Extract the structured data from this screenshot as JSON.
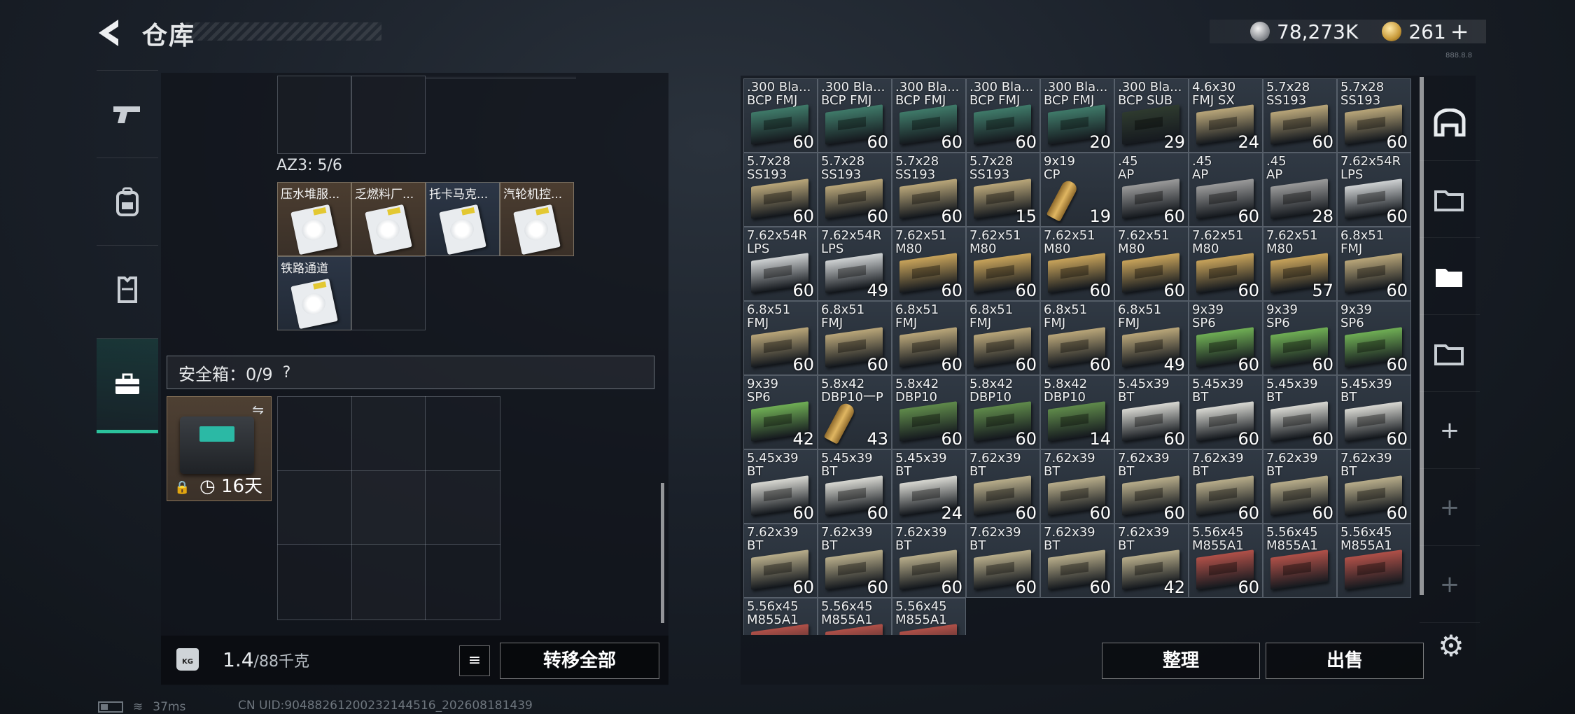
{
  "header": {
    "title": "仓库",
    "silver": "78,273K",
    "gold": "261",
    "plus": "+",
    "version": "888.8.8"
  },
  "left_tabs": [
    "weapon",
    "backpack",
    "vest",
    "safe-box"
  ],
  "az_label": "AZ3: 5/6",
  "az_items": [
    {
      "name": "压水堆服...",
      "style": "brown"
    },
    {
      "name": "乏燃料厂...",
      "style": "brown"
    },
    {
      "name": "托卡马克...",
      "style": "blue"
    },
    {
      "name": "汽轮机控...",
      "style": "brown"
    },
    {
      "name": "铁路通道",
      "style": "blue"
    }
  ],
  "safe": {
    "label": "安全箱：0/9",
    "help": "?",
    "timer": "16天",
    "swap": "⇋",
    "lock": "🔒"
  },
  "weight": {
    "value": "1.4",
    "unit": "/88千克",
    "kg": "KG"
  },
  "buttons": {
    "transfer_all": "转移全部",
    "organize": "整理",
    "sell": "出售",
    "list": "≡"
  },
  "right_tabs": [
    "stash-main",
    "stash-1",
    "stash-2",
    "stash-3",
    "add",
    "add",
    "add"
  ],
  "ammo": [
    {
      "label": ".300 Bla...\nBCP FMJ",
      "qty": "60",
      "color": "#3f7a69"
    },
    {
      "label": ".300 Bla...\nBCP FMJ",
      "qty": "60",
      "color": "#3f7a69"
    },
    {
      "label": ".300 Bla...\nBCP FMJ",
      "qty": "60",
      "color": "#3f7a69"
    },
    {
      "label": ".300 Bla...\nBCP FMJ",
      "qty": "60",
      "color": "#3f7a69"
    },
    {
      "label": ".300 Bla...\nBCP FMJ",
      "qty": "20",
      "color": "#3f7a69"
    },
    {
      "label": ".300 Bla...\nBCP SUB",
      "qty": "29",
      "color": "#2e3a2e"
    },
    {
      "label": "4.6x30\nFMJ SX",
      "qty": "24",
      "color": "#b9a679"
    },
    {
      "label": "5.7x28\nSS193",
      "qty": "60",
      "color": "#b9a679"
    },
    {
      "label": "5.7x28\nSS193",
      "qty": "60",
      "color": "#b9a679"
    },
    {
      "label": "5.7x28\nSS193",
      "qty": "60",
      "color": "#b9a679"
    },
    {
      "label": "5.7x28\nSS193",
      "qty": "60",
      "color": "#b9a679"
    },
    {
      "label": "5.7x28\nSS193",
      "qty": "60",
      "color": "#b9a679"
    },
    {
      "label": "5.7x28\nSS193",
      "qty": "15",
      "color": "#b9a679"
    },
    {
      "label": "9x19\nCP",
      "qty": "19",
      "color": "#bullet"
    },
    {
      "label": ".45\nAP",
      "qty": "60",
      "color": "#9a9a9a"
    },
    {
      "label": ".45\nAP",
      "qty": "60",
      "color": "#9a9a9a"
    },
    {
      "label": ".45\nAP",
      "qty": "28",
      "color": "#9a9a9a"
    },
    {
      "label": "7.62x54R\nLPS",
      "qty": "60",
      "color": "#cfd2d3"
    },
    {
      "label": "7.62x54R\nLPS",
      "qty": "60",
      "color": "#cfd2d3"
    },
    {
      "label": "7.62x54R\nLPS",
      "qty": "49",
      "color": "#cfd2d3"
    },
    {
      "label": "7.62x51\nM80",
      "qty": "60",
      "color": "#c8a35a"
    },
    {
      "label": "7.62x51\nM80",
      "qty": "60",
      "color": "#c8a35a"
    },
    {
      "label": "7.62x51\nM80",
      "qty": "60",
      "color": "#c8a35a"
    },
    {
      "label": "7.62x51\nM80",
      "qty": "60",
      "color": "#c8a35a"
    },
    {
      "label": "7.62x51\nM80",
      "qty": "60",
      "color": "#c8a35a"
    },
    {
      "label": "7.62x51\nM80",
      "qty": "57",
      "color": "#c8a35a"
    },
    {
      "label": "6.8x51\nFMJ",
      "qty": "60",
      "color": "#b9a679"
    },
    {
      "label": "6.8x51\nFMJ",
      "qty": "60",
      "color": "#b9a679"
    },
    {
      "label": "6.8x51\nFMJ",
      "qty": "60",
      "color": "#b9a679"
    },
    {
      "label": "6.8x51\nFMJ",
      "qty": "60",
      "color": "#b9a679"
    },
    {
      "label": "6.8x51\nFMJ",
      "qty": "60",
      "color": "#b9a679"
    },
    {
      "label": "6.8x51\nFMJ",
      "qty": "60",
      "color": "#b9a679"
    },
    {
      "label": "6.8x51\nFMJ",
      "qty": "49",
      "color": "#b9a679"
    },
    {
      "label": "9x39\nSP6",
      "qty": "60",
      "color": "#6fae54"
    },
    {
      "label": "9x39\nSP6",
      "qty": "60",
      "color": "#6fae54"
    },
    {
      "label": "9x39\nSP6",
      "qty": "60",
      "color": "#6fae54"
    },
    {
      "label": "9x39\nSP6",
      "qty": "42",
      "color": "#6fae54"
    },
    {
      "label": "5.8x42\nDBP10一P",
      "qty": "43",
      "color": "#bullet"
    },
    {
      "label": "5.8x42\nDBP10",
      "qty": "60",
      "color": "#5f8a4a"
    },
    {
      "label": "5.8x42\nDBP10",
      "qty": "60",
      "color": "#5f8a4a"
    },
    {
      "label": "5.8x42\nDBP10",
      "qty": "14",
      "color": "#5f8a4a"
    },
    {
      "label": "5.45x39\nBT",
      "qty": "60",
      "color": "#d8d8d2"
    },
    {
      "label": "5.45x39\nBT",
      "qty": "60",
      "color": "#d8d8d2"
    },
    {
      "label": "5.45x39\nBT",
      "qty": "60",
      "color": "#d8d8d2"
    },
    {
      "label": "5.45x39\nBT",
      "qty": "60",
      "color": "#d8d8d2"
    },
    {
      "label": "5.45x39\nBT",
      "qty": "60",
      "color": "#d8d8d2"
    },
    {
      "label": "5.45x39\nBT",
      "qty": "60",
      "color": "#d8d8d2"
    },
    {
      "label": "5.45x39\nBT",
      "qty": "24",
      "color": "#d8d8d2"
    },
    {
      "label": "7.62x39\nBT",
      "qty": "60",
      "color": "#b8ad8a"
    },
    {
      "label": "7.62x39\nBT",
      "qty": "60",
      "color": "#b8ad8a"
    },
    {
      "label": "7.62x39\nBT",
      "qty": "60",
      "color": "#b8ad8a"
    },
    {
      "label": "7.62x39\nBT",
      "qty": "60",
      "color": "#b8ad8a"
    },
    {
      "label": "7.62x39\nBT",
      "qty": "60",
      "color": "#b8ad8a"
    },
    {
      "label": "7.62x39\nBT",
      "qty": "60",
      "color": "#b8ad8a"
    },
    {
      "label": "7.62x39\nBT",
      "qty": "60",
      "color": "#b8ad8a"
    },
    {
      "label": "7.62x39\nBT",
      "qty": "60",
      "color": "#b8ad8a"
    },
    {
      "label": "7.62x39\nBT",
      "qty": "60",
      "color": "#b8ad8a"
    },
    {
      "label": "7.62x39\nBT",
      "qty": "60",
      "color": "#b8ad8a"
    },
    {
      "label": "7.62x39\nBT",
      "qty": "60",
      "color": "#b8ad8a"
    },
    {
      "label": "7.62x39\nBT",
      "qty": "42",
      "color": "#b8ad8a"
    },
    {
      "label": "5.56x45\nM855A1",
      "qty": "60",
      "color": "#b05048"
    },
    {
      "label": "5.56x45\nM855A1",
      "qty": "",
      "color": "#b05048"
    },
    {
      "label": "5.56x45\nM855A1",
      "qty": "",
      "color": "#b05048"
    },
    {
      "label": "5.56x45\nM855A1",
      "qty": "",
      "color": "#b05048"
    },
    {
      "label": "5.56x45\nM855A1",
      "qty": "",
      "color": "#b05048"
    },
    {
      "label": "5.56x45\nM855A1",
      "qty": "",
      "color": "#b05048"
    }
  ],
  "status": {
    "ping": "37ms",
    "uid": "CN UID:904882612002321445​16_202608181439"
  }
}
